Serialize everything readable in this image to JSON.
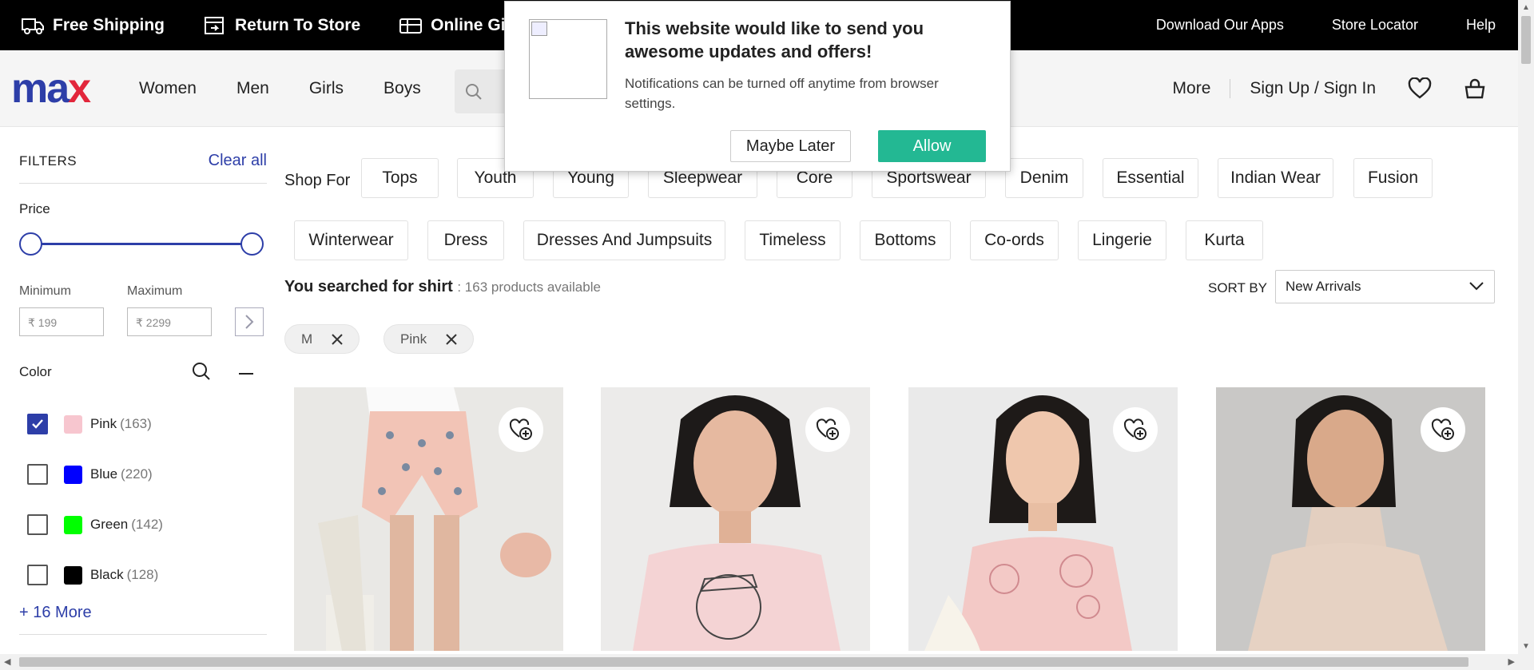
{
  "topbar": {
    "promos": [
      "Free Shipping",
      "Return To Store",
      "Online Gift"
    ],
    "links": [
      "Download Our Apps",
      "Store Locator",
      "Help"
    ]
  },
  "header": {
    "logo": {
      "part1": "ma",
      "part2": "x"
    },
    "nav": [
      "Women",
      "Men",
      "Girls",
      "Boys"
    ],
    "more": "More",
    "signin": "Sign Up / Sign In"
  },
  "filters": {
    "title": "FILTERS",
    "clear": "Clear all",
    "price_title": "Price",
    "min_label": "Minimum",
    "max_label": "Maximum",
    "min_placeholder": "₹ 199",
    "max_placeholder": "₹ 2299",
    "color_title": "Color",
    "colors": [
      {
        "name": "Pink",
        "count": "(163)",
        "checked": true,
        "hex": "#f7c6cf"
      },
      {
        "name": "Blue",
        "count": "(220)",
        "checked": false,
        "hex": "#0000ff"
      },
      {
        "name": "Green",
        "count": "(142)",
        "checked": false,
        "hex": "#00ff00"
      },
      {
        "name": "Black",
        "count": "(128)",
        "checked": false,
        "hex": "#000000"
      }
    ],
    "more_link": "+ 16 More"
  },
  "shop_for": {
    "label": "Shop For",
    "row1": [
      "Tops",
      "Youth",
      "Young",
      "Sleepwear",
      "Core",
      "Sportswear",
      "Denim",
      "Essential",
      "Indian Wear",
      "Fusion"
    ],
    "row2": [
      "Winterwear",
      "Dress",
      "Dresses And Jumpsuits",
      "Timeless",
      "Bottoms",
      "Co-ords",
      "Lingerie",
      "Kurta"
    ]
  },
  "results": {
    "searched": "You searched for shirt",
    "count": ": 163 products available",
    "sort_label": "SORT BY",
    "sort_value": "New Arrivals",
    "tags": [
      "M",
      "Pink"
    ]
  },
  "popup": {
    "title": "This website would like to send you awesome updates and offers!",
    "desc": "Notifications can be turned off anytime from browser settings.",
    "later": "Maybe Later",
    "allow": "Allow"
  },
  "colors": {
    "brand_blue": "#2d3ea8",
    "brand_red": "#e2263b",
    "allow_green": "#23b893"
  }
}
